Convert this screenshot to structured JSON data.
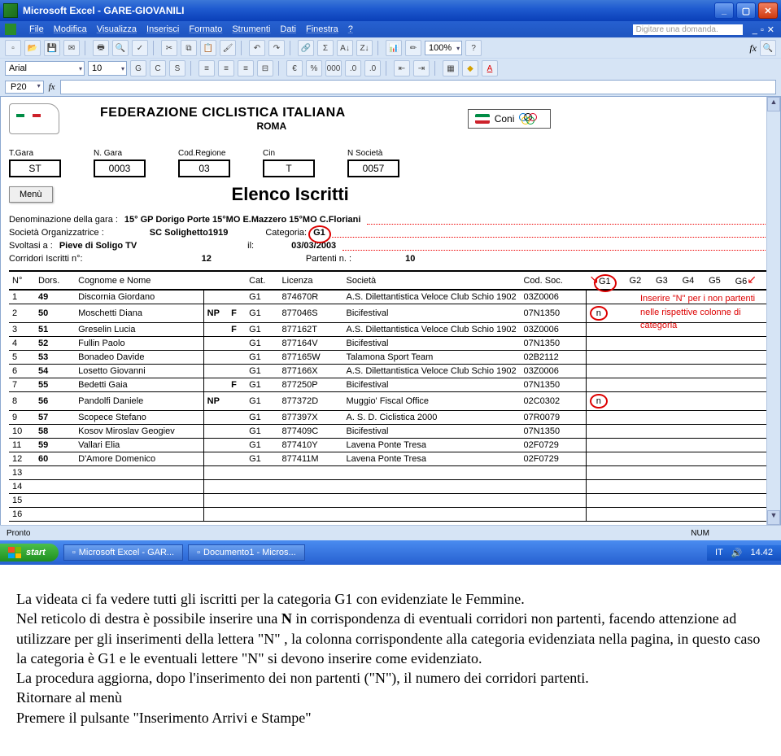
{
  "titlebar": {
    "appname": "Microsoft Excel",
    "doc": "GARE-GIOVANILI"
  },
  "menu": {
    "items": [
      "File",
      "Modifica",
      "Visualizza",
      "Inserisci",
      "Formato",
      "Strumenti",
      "Dati",
      "Finestra",
      "?"
    ],
    "ask_placeholder": "Digitare una domanda."
  },
  "toolbar2": {
    "font": "Arial",
    "size": "10",
    "items_bold": [
      "G",
      "C",
      "S"
    ],
    "zoom": "100%"
  },
  "namebox": {
    "cell": "P20"
  },
  "header": {
    "federation": "FEDERAZIONE CICLISTICA ITALIANA",
    "city": "ROMA",
    "coni": "Coni"
  },
  "fields": {
    "t_gara_label": "T.Gara",
    "t_gara": "ST",
    "n_gara_label": "N. Gara",
    "n_gara": "0003",
    "cod_reg_label": "Cod.Regione",
    "cod_reg": "03",
    "cin_label": "Cin",
    "cin": "T",
    "n_soc_label": "N Società",
    "n_soc": "0057"
  },
  "menu_btn": "Menù",
  "elenco": "Elenco Iscritti",
  "info": {
    "denom_label": "Denominazione della gara :",
    "denom": "15° GP Dorigo Porte 15°MO E.Mazzero 15°MO C.Floriani",
    "soc_label": "Società Organizzatrice :",
    "soc": "SC Solighetto1919",
    "cat_label": "Categoria:",
    "cat": "G1",
    "svolt_label": "Svoltasi a :",
    "svolt": "Pieve di Soligo TV",
    "il_label": "il:",
    "il": "03/03/2003",
    "iscr_label": "Corridori Iscritti n°:",
    "iscr": "12",
    "part_label": "Partenti n. :",
    "part": "10"
  },
  "red_note": {
    "l1": "Inserire \"N\" per i non partenti",
    "l2": "nelle rispettive colonne di",
    "l3": "categoria"
  },
  "th": {
    "n": "N°",
    "dors": "Dors.",
    "nome": "Cognome e Nome",
    "cat": "Cat.",
    "lic": "Licenza",
    "soc": "Società",
    "cods": "Cod. Soc.",
    "g1": "G1",
    "g2": "G2",
    "g3": "G3",
    "g4": "G4",
    "g5": "G5",
    "g6": "G6"
  },
  "rows": [
    {
      "n": "1",
      "d": "49",
      "nome": "Discornia Giordano",
      "np": "",
      "f": "",
      "cat": "G1",
      "lic": "874670R",
      "soc": "A.S. Dilettantistica Veloce Club Schio 1902",
      "cs": "03Z0006",
      "g1": ""
    },
    {
      "n": "2",
      "d": "50",
      "nome": "Moschetti Diana",
      "np": "NP",
      "f": "F",
      "cat": "G1",
      "lic": "877046S",
      "soc": "Bicifestival",
      "cs": "07N1350",
      "g1": "n"
    },
    {
      "n": "3",
      "d": "51",
      "nome": "Greselin Lucia",
      "np": "",
      "f": "F",
      "cat": "G1",
      "lic": "877162T",
      "soc": "A.S. Dilettantistica Veloce Club Schio 1902",
      "cs": "03Z0006",
      "g1": ""
    },
    {
      "n": "4",
      "d": "52",
      "nome": "Fullin Paolo",
      "np": "",
      "f": "",
      "cat": "G1",
      "lic": "877164V",
      "soc": "Bicifestival",
      "cs": "07N1350",
      "g1": ""
    },
    {
      "n": "5",
      "d": "53",
      "nome": "Bonadeo Davide",
      "np": "",
      "f": "",
      "cat": "G1",
      "lic": "877165W",
      "soc": "Talamona Sport Team",
      "cs": "02B2112",
      "g1": ""
    },
    {
      "n": "6",
      "d": "54",
      "nome": "Losetto Giovanni",
      "np": "",
      "f": "",
      "cat": "G1",
      "lic": "877166X",
      "soc": "A.S. Dilettantistica Veloce Club Schio 1902",
      "cs": "03Z0006",
      "g1": ""
    },
    {
      "n": "7",
      "d": "55",
      "nome": "Bedetti Gaia",
      "np": "",
      "f": "F",
      "cat": "G1",
      "lic": "877250P",
      "soc": "Bicifestival",
      "cs": "07N1350",
      "g1": ""
    },
    {
      "n": "8",
      "d": "56",
      "nome": "Pandolfi Daniele",
      "np": "NP",
      "f": "",
      "cat": "G1",
      "lic": "877372D",
      "soc": "Muggio' Fiscal Office",
      "cs": "02C0302",
      "g1": "n"
    },
    {
      "n": "9",
      "d": "57",
      "nome": "Scopece Stefano",
      "np": "",
      "f": "",
      "cat": "G1",
      "lic": "877397X",
      "soc": "A. S. D. Ciclistica 2000",
      "cs": "07R0079",
      "g1": ""
    },
    {
      "n": "10",
      "d": "58",
      "nome": "Kosov Miroslav Geogiev",
      "np": "",
      "f": "",
      "cat": "G1",
      "lic": "877409C",
      "soc": "Bicifestival",
      "cs": "07N1350",
      "g1": ""
    },
    {
      "n": "11",
      "d": "59",
      "nome": "Vallari Elia",
      "np": "",
      "f": "",
      "cat": "G1",
      "lic": "877410Y",
      "soc": "Lavena Ponte Tresa",
      "cs": "02F0729",
      "g1": ""
    },
    {
      "n": "12",
      "d": "60",
      "nome": "D'Amore Domenico",
      "np": "",
      "f": "",
      "cat": "G1",
      "lic": "877411M",
      "soc": "Lavena Ponte Tresa",
      "cs": "02F0729",
      "g1": ""
    }
  ],
  "empty_rows": [
    "13",
    "14",
    "15",
    "16"
  ],
  "status": {
    "ready": "Pronto",
    "num": "NUM"
  },
  "taskbar": {
    "start": "start",
    "task1": "Microsoft Excel - GAR...",
    "task2": "Documento1 - Micros...",
    "lang": "IT",
    "time": "14.42"
  },
  "instr": {
    "p1": "La videata ci fa vedere tutti gli iscritti per la categoria G1 con evidenziate le Femmine.",
    "p2a": "Nel reticolo di destra è possibile inserire una ",
    "p2b": "N",
    "p2c": " in corrispondenza di eventuali corridori non partenti, facendo attenzione ad utilizzare per gli inserimenti della lettera \"N\" , la colonna corrispondente alla categoria evidenziata nella pagina, in questo caso la categoria è G1 e le eventuali lettere \"N\" si devono inserire come evidenziato.",
    "p3": "La procedura aggiorna, dopo l'inserimento dei non partenti (\"N\"), il numero dei corridori partenti.",
    "p4": "Ritornare al menù",
    "p5": "Premere il pulsante \"Inserimento Arrivi e Stampe\""
  }
}
